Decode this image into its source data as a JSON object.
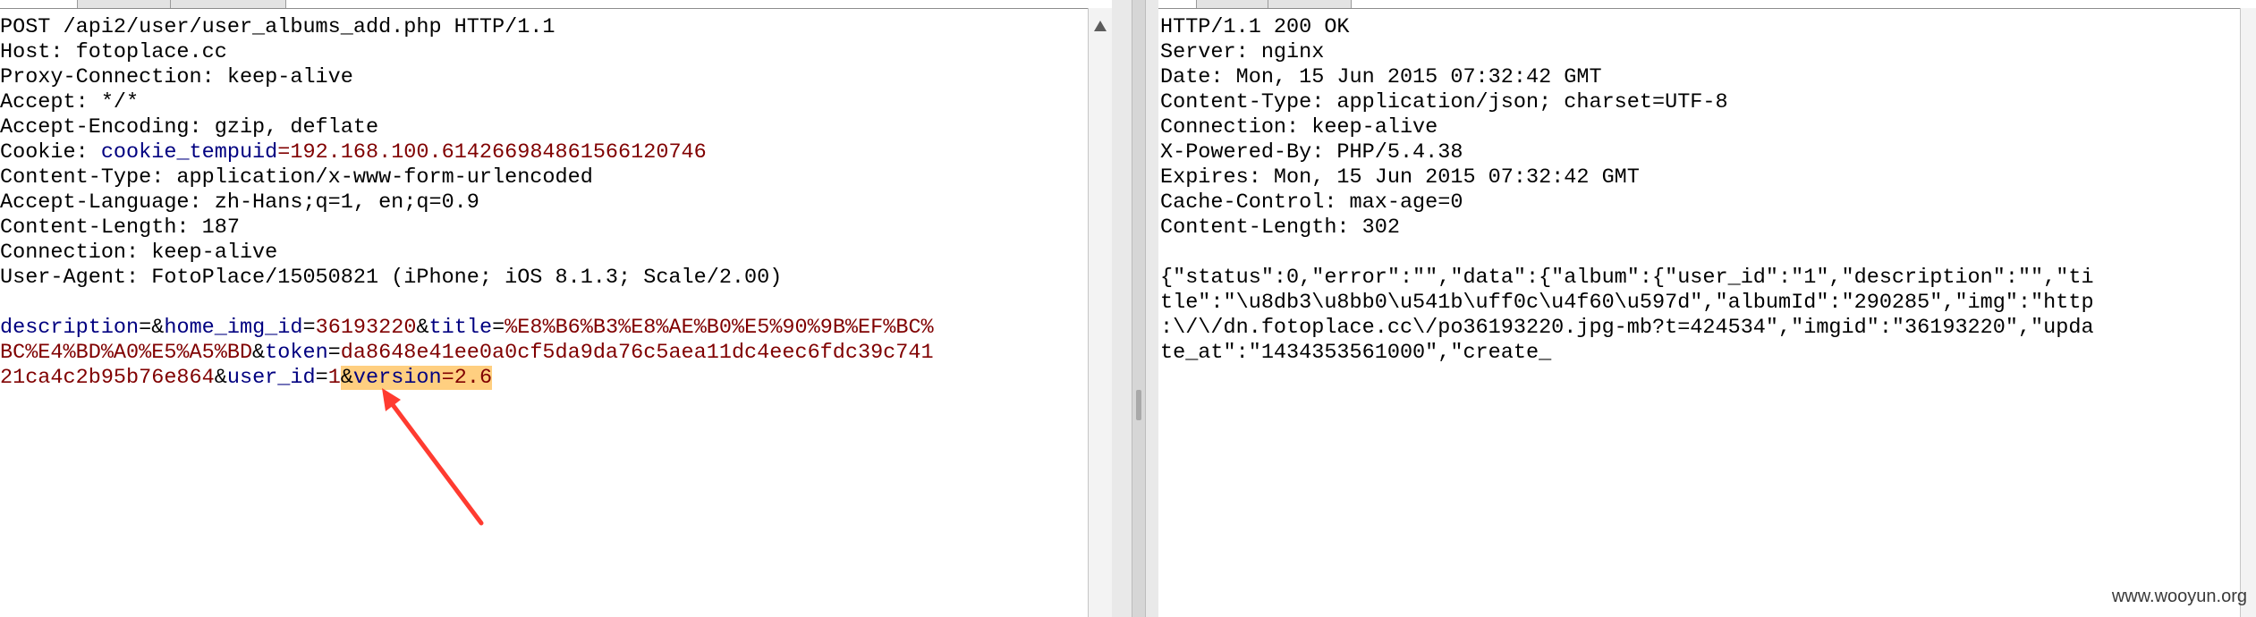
{
  "request": {
    "lines": [
      "POST /api2/user/user_albums_add.php HTTP/1.1",
      "Host: fotoplace.cc",
      "Proxy-Connection: keep-alive",
      "Accept: */*",
      "Accept-Encoding: gzip, deflate"
    ],
    "cookie": {
      "prefix": "Cookie: ",
      "key": "cookie_tempuid",
      "eq": "=",
      "value": "192.168.100.614266984861566120746"
    },
    "lines2": [
      "Content-Type: application/x-www-form-urlencoded",
      "Accept-Language: zh-Hans;q=1, en;q=0.9",
      "Content-Length: 187",
      "Connection: keep-alive",
      "User-Agent: FotoPlace/15050821 (iPhone; iOS 8.1.3; Scale/2.00)"
    ],
    "body": {
      "l1": {
        "k1": "description",
        "eq1": "=&",
        "k2": "home_img_id",
        "eq2": "=",
        "v2": "36193220",
        "amp2": "&",
        "k3": "title",
        "eq3": "=",
        "v3": "%E8%B6%B3%E8%AE%B0%E5%90%9B%EF%BC%"
      },
      "l2": {
        "v3b": "BC%E4%BD%A0%E5%A5%BD",
        "amp": "&",
        "k4": "token",
        "eq4": "=",
        "v4": "da8648e41ee0a0cf5da9da76c5aea11dc4eec6fdc39c741"
      },
      "l3": {
        "v4b": "21ca4c2b95b76e864",
        "amp": "&",
        "k5": "user_id",
        "eq5": "=",
        "v5": "1",
        "amp6": "&",
        "k6": "version",
        "eq6": "=",
        "v6": "2.6"
      }
    }
  },
  "response": {
    "lines": [
      "HTTP/1.1 200 OK",
      "Server: nginx",
      "Date: Mon, 15 Jun 2015 07:32:42 GMT",
      "Content-Type: application/json; charset=UTF-8",
      "Connection: keep-alive",
      "X-Powered-By: PHP/5.4.38",
      "Expires: Mon, 15 Jun 2015 07:32:42 GMT",
      "Cache-Control: max-age=0",
      "Content-Length: 302"
    ],
    "body": [
      "{\"status\":0,\"error\":\"\",\"data\":{\"album\":{\"user_id\":\"1\",\"description\":\"\",\"ti",
      "tle\":\"\\u8db3\\u8bb0\\u541b\\uff0c\\u4f60\\u597d\",\"albumId\":\"290285\",\"img\":\"http",
      ":\\/\\/dn.fotoplace.cc\\/po36193220.jpg-mb?t=424534\",\"imgid\":\"36193220\",\"upda",
      "te_at\":\"1434353561000\",\"create_"
    ]
  },
  "watermark": "www.wooyun.org",
  "colors": {
    "param_key": "#000080",
    "param_value": "#800000",
    "highlight": "#ffcf80",
    "arrow": "#ff3b30"
  },
  "icons": {
    "scroll_up": "triangle-up-icon",
    "annotation": "red-arrow-icon"
  }
}
